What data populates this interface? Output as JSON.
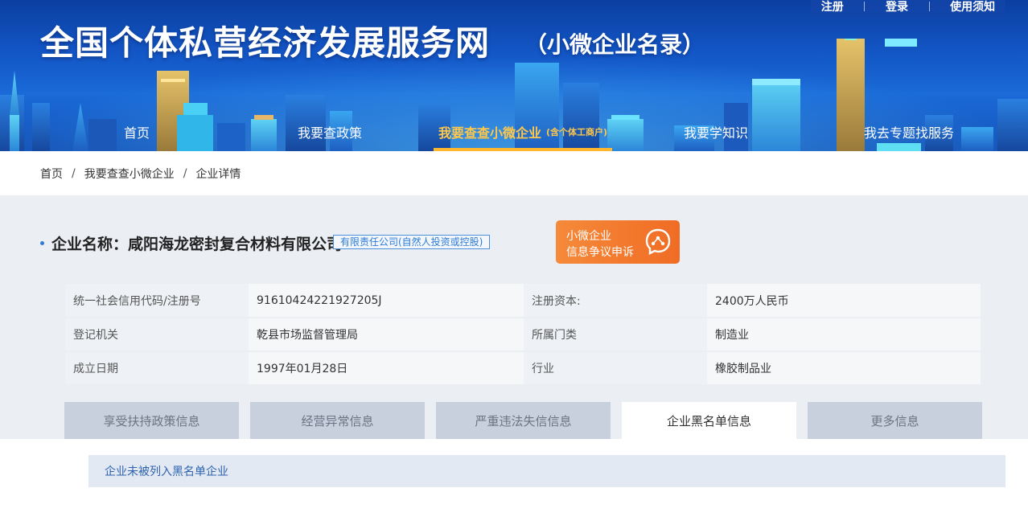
{
  "header": {
    "site_title": "全国个体私营经济发展服务网",
    "site_subtitle": "（小微企业名录）",
    "top_links": [
      "注册",
      "登录",
      "使用须知"
    ]
  },
  "nav": {
    "items": [
      {
        "label": "首页"
      },
      {
        "label": "我要查政策"
      },
      {
        "label": "我要查查小微企业",
        "sub": "(含个体工商户)",
        "active": true
      },
      {
        "label": "我要学知识"
      },
      {
        "label": "我去专题找服务"
      }
    ]
  },
  "breadcrumb": [
    "首页",
    "我要查查小微企业",
    "企业详情"
  ],
  "company": {
    "name_label": "企业名称：",
    "name": "咸阳海龙密封复合材料有限公司",
    "type": "有限责任公司(自然人投资或控股)",
    "appeal_button": {
      "line1": "小微企业",
      "line2": "信息争议申诉"
    }
  },
  "info_rows": [
    {
      "k1": "统一社会信用代码/注册号",
      "v1": "91610424221927205J",
      "k2": "注册资本:",
      "v2": "2400万人民币"
    },
    {
      "k1": "登记机关",
      "v1": "乾县市场监督管理局",
      "k2": "所属门类",
      "v2": "制造业"
    },
    {
      "k1": "成立日期",
      "v1": "1997年01月28日",
      "k2": "行业",
      "v2": "橡胶制品业"
    }
  ],
  "tabs": [
    {
      "label": "享受扶持政策信息",
      "active": false
    },
    {
      "label": "经营异常信息",
      "active": false
    },
    {
      "label": "严重违法失信信息",
      "active": false
    },
    {
      "label": "企业黑名单信息",
      "active": true
    },
    {
      "label": "更多信息",
      "active": false
    }
  ],
  "content": {
    "notice": "企业未被列入黑名单企业"
  },
  "colors": {
    "banner_blue": "#1356c6",
    "nav_active": "#ffc84a",
    "appeal_orange": "#f06c24",
    "panel_gray": "#ebeef2",
    "tab_inactive": "#c7d0dc",
    "notice_bg": "#e2e9f3",
    "notice_text": "#2e63ad"
  }
}
